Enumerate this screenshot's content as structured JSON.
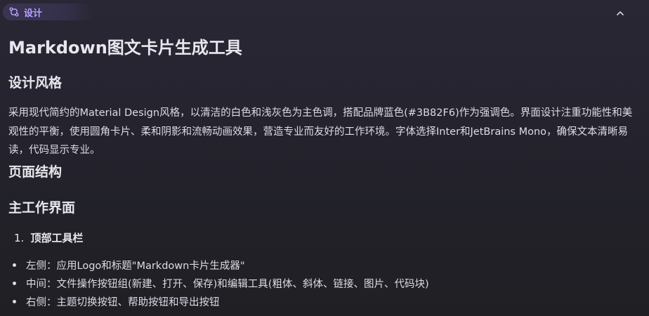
{
  "tag": {
    "label": "设计",
    "icon": "branch-icon",
    "color": "#b9a2ff"
  },
  "collapse": {
    "icon": "chevron-up-icon"
  },
  "doc": {
    "title": "Markdown图文卡片生成工具",
    "style_heading": "设计风格",
    "style_paragraph": "采用现代简约的Material Design风格，以清洁的白色和浅灰色为主色调，搭配品牌蓝色(#3B82F6)作为强调色。界面设计注重功能性和美观性的平衡，使用圆角卡片、柔和阴影和流畅动画效果，营造专业而友好的工作环境。字体选择Inter和JetBrains Mono，确保文本清晰易读，代码显示专业。",
    "structure_heading": "页面结构",
    "main_heading": "主工作界面",
    "ordered_item_number": "1.",
    "ordered_item": "顶部工具栏",
    "bullets": [
      "左侧：应用Logo和标题\"Markdown卡片生成器\"",
      "中间：文件操作按钮组(新建、打开、保存)和编辑工具(粗体、斜体、链接、图片、代码块)",
      "右侧：主题切换按钮、帮助按钮和导出按钮"
    ]
  }
}
